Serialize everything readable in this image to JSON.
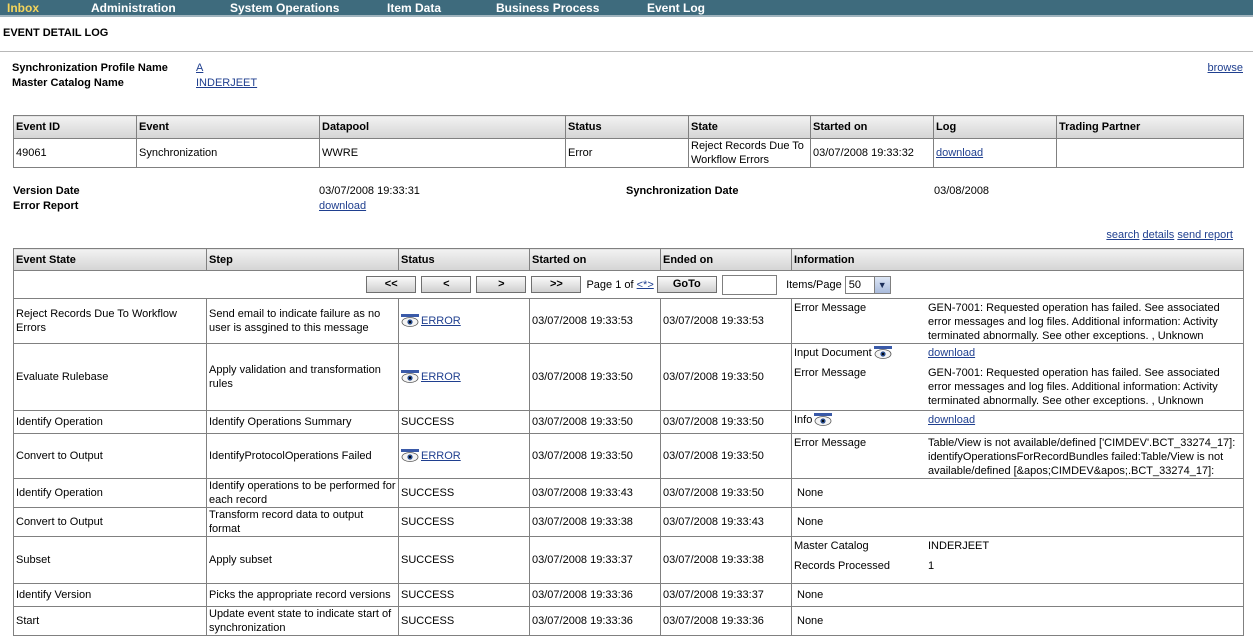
{
  "nav": {
    "items": [
      "Inbox",
      "Administration",
      "System Operations",
      "Item Data",
      "Business Process",
      "Event Log"
    ]
  },
  "page_title": "EVENT DETAIL LOG",
  "summary": {
    "profile_label": "Synchronization Profile Name",
    "profile_value": "A",
    "catalog_label": "Master Catalog Name",
    "catalog_value": "INDERJEET",
    "browse": "browse"
  },
  "event_table": {
    "headers": [
      "Event ID",
      "Event",
      "Datapool",
      "Status",
      "State",
      "Started on",
      "Log",
      "Trading Partner"
    ],
    "row": {
      "event_id": "49061",
      "event": "Synchronization",
      "datapool": "WWRE",
      "status": "Error",
      "state": "Reject Records Due To Workflow Errors",
      "started_on": "03/07/2008 19:33:32",
      "log": "download",
      "trading_partner": ""
    }
  },
  "details": {
    "version_date_label": "Version Date",
    "version_date_value": "03/07/2008 19:33:31",
    "sync_date_label": "Synchronization Date",
    "sync_date_value": "03/08/2008",
    "error_report_label": "Error Report",
    "error_report_value": "download"
  },
  "actions": {
    "search": "search",
    "details": "details",
    "send_report": "send report"
  },
  "state_table": {
    "headers": [
      "Event State",
      "Step",
      "Status",
      "Started on",
      "Ended on",
      "Information"
    ],
    "pager": {
      "first": "<<",
      "prev": "<",
      "next": ">",
      "last": ">>",
      "page_text": "Page 1 of",
      "page_link": "<*>",
      "goto": "GoTo",
      "items_label": "Items/Page",
      "items_value": "50"
    },
    "rows": [
      {
        "state": "Reject Records Due To Workflow Errors",
        "step": "Send email to indicate failure as no user is assgined to this message",
        "status": "ERROR",
        "started": "03/07/2008 19:33:53",
        "ended": "03/07/2008 19:33:53",
        "info": [
          {
            "key": "Error Message",
            "value": "GEN-7001: Requested operation has failed. See associated error messages and log files. Additional information: Activity terminated abnormally. See other exceptions. , Unknown"
          }
        ]
      },
      {
        "state": "Evaluate Rulebase",
        "step": "Apply validation and transformation rules",
        "status": "ERROR",
        "started": "03/07/2008 19:33:50",
        "ended": "03/07/2008 19:33:50",
        "info": [
          {
            "key": "Input Document",
            "value": "download"
          },
          {
            "key": "Error Message",
            "value": "GEN-7001: Requested operation has failed. See associated error messages and log files. Additional information: Activity terminated abnormally. See other exceptions. , Unknown"
          }
        ]
      },
      {
        "state": "Identify Operation",
        "step": "Identify Operations Summary",
        "status": "SUCCESS",
        "started": "03/07/2008 19:33:50",
        "ended": "03/07/2008 19:33:50",
        "info": [
          {
            "key": "Info",
            "value": "download"
          }
        ]
      },
      {
        "state": "Convert to Output",
        "step": "IdentifyProtocolOperations Failed",
        "status": "ERROR",
        "started": "03/07/2008 19:33:50",
        "ended": "03/07/2008 19:33:50",
        "info": [
          {
            "key": "Error Message",
            "value": "Table/View is not available/defined ['CIMDEV'.BCT_33274_17]: identifyOperationsForRecordBundles failed:Table/View is not available/defined [&apos;CIMDEV&apos;.BCT_33274_17]:"
          }
        ]
      },
      {
        "state": "Identify Operation",
        "step": "Identify operations to be performed for each record",
        "status": "SUCCESS",
        "started": "03/07/2008 19:33:43",
        "ended": "03/07/2008 19:33:50",
        "info_text": "None"
      },
      {
        "state": "Convert to Output",
        "step": "Transform record data to output format",
        "status": "SUCCESS",
        "started": "03/07/2008 19:33:38",
        "ended": "03/07/2008 19:33:43",
        "info_text": "None"
      },
      {
        "state": "Subset",
        "step": "Apply subset",
        "status": "SUCCESS",
        "started": "03/07/2008 19:33:37",
        "ended": "03/07/2008 19:33:38",
        "info": [
          {
            "key": "Master Catalog",
            "value": "INDERJEET"
          },
          {
            "key": "Records Processed",
            "value": "1"
          }
        ]
      },
      {
        "state": "Identify Version",
        "step": "Picks the appropriate record versions",
        "status": "SUCCESS",
        "started": "03/07/2008 19:33:36",
        "ended": "03/07/2008 19:33:37",
        "info_text": "None"
      },
      {
        "state": "Start",
        "step": "Update event state to indicate start of synchronization",
        "status": "SUCCESS",
        "started": "03/07/2008 19:33:36",
        "ended": "03/07/2008 19:33:36",
        "info_text": "None"
      }
    ]
  }
}
